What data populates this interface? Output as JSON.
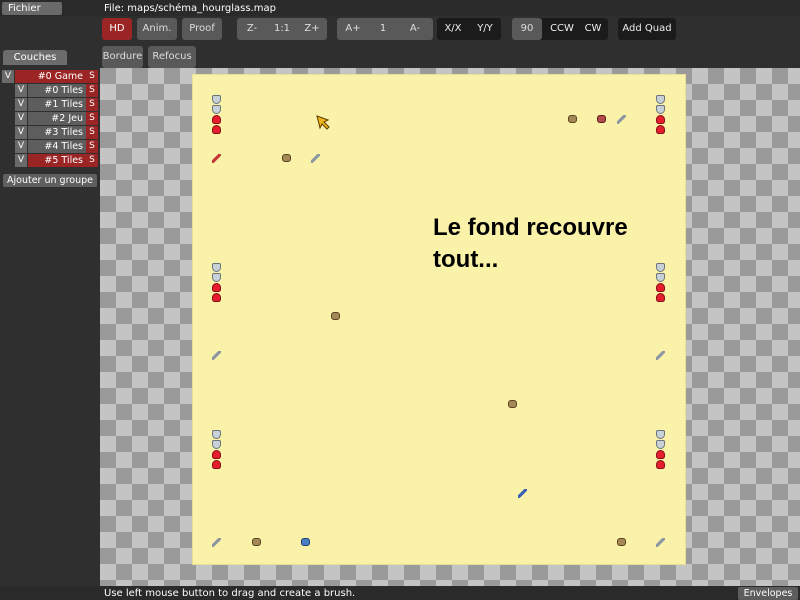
{
  "menu": {
    "file": "Fichier"
  },
  "file_label": "File: maps/schéma_hourglass.map",
  "toolbar": {
    "hd": "HD",
    "anim": "Anim.",
    "proof": "Proof",
    "zoom_out": "Z-",
    "zoom_reset": "1:1",
    "zoom_in": "Z+",
    "anim_speed_up": "A+",
    "anim_speed": "1",
    "anim_speed_down": "A-",
    "flip_x": "X/X",
    "flip_y": "Y/Y",
    "rotate_angle": "90",
    "rotate_ccw": "CCW",
    "rotate_cw": "CW",
    "add_quad": "Add Quad",
    "bordure": "Bordure",
    "refocus": "Refocus"
  },
  "sidebar": {
    "tab": "Couches",
    "layers": [
      {
        "vis": "V",
        "name": "#0 Game",
        "s": "S",
        "type": "group"
      },
      {
        "vis": "V",
        "name": "#0 Tiles",
        "s": "S",
        "type": "layer"
      },
      {
        "vis": "V",
        "name": "#1 Tiles",
        "s": "S",
        "type": "layer"
      },
      {
        "vis": "V",
        "name": "#2 Jeu",
        "s": "S",
        "type": "layer"
      },
      {
        "vis": "V",
        "name": "#3 Tiles",
        "s": "S",
        "type": "layer"
      },
      {
        "vis": "V",
        "name": "#4 Tiles",
        "s": "S",
        "type": "layer"
      },
      {
        "vis": "V",
        "name": "#5 Tiles",
        "s": "S",
        "type": "layer-selected"
      }
    ],
    "add_group": "Ajouter un groupe"
  },
  "map": {
    "note": "Le fond recouvre tout..."
  },
  "status": {
    "hint": "Use left mouse button to drag and create a brush.",
    "envelopes": "Envelopes"
  },
  "colors": {
    "accent_red": "#9b2525",
    "map_background": "#fbf2a9"
  }
}
